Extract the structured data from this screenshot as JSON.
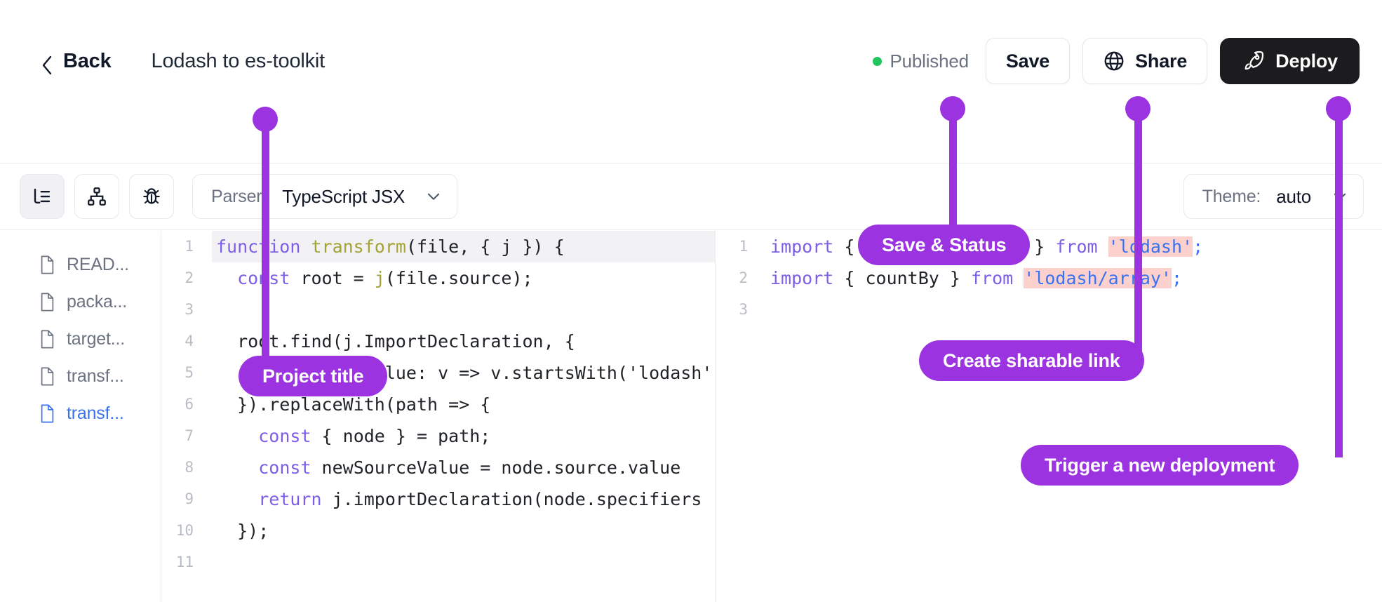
{
  "header": {
    "back_label": "Back",
    "back_icon": "chevron-left-icon",
    "project_title": "Lodash to es-toolkit",
    "status_text": "Published",
    "status_color": "#22c55e",
    "save_label": "Save",
    "share_label": "Share",
    "share_icon": "globe-icon",
    "deploy_label": "Deploy",
    "deploy_icon": "rocket-icon"
  },
  "toolbar": {
    "buttons": [
      {
        "name": "list-tree-icon",
        "active": true
      },
      {
        "name": "sitemap-icon",
        "active": false
      },
      {
        "name": "bug-icon",
        "active": false
      }
    ],
    "parser": {
      "label": "Parser:",
      "value": "TypeScript JSX",
      "chevron": "chevron-down-icon"
    },
    "theme": {
      "label": "Theme:",
      "value": "auto",
      "chevron": "chevron-down-icon"
    }
  },
  "files": [
    {
      "name": "READ...",
      "selected": false
    },
    {
      "name": "packa...",
      "selected": false
    },
    {
      "name": "target...",
      "selected": false
    },
    {
      "name": "transf...",
      "selected": false
    },
    {
      "name": "transf...",
      "selected": true
    }
  ],
  "left_editor": {
    "lines": [
      {
        "n": "1",
        "highlight": true,
        "tokens": [
          {
            "t": "function ",
            "c": "kw"
          },
          {
            "t": "transform",
            "c": "fn"
          },
          {
            "t": "(file, { j }) {",
            "c": "plain"
          }
        ]
      },
      {
        "n": "2",
        "highlight": false,
        "tokens": [
          {
            "t": "  ",
            "c": "plain"
          },
          {
            "t": "const",
            "c": "kw"
          },
          {
            "t": " root = ",
            "c": "plain"
          },
          {
            "t": "j",
            "c": "var"
          },
          {
            "t": "(file.source);",
            "c": "plain"
          }
        ]
      },
      {
        "n": "3",
        "highlight": false,
        "tokens": []
      },
      {
        "n": "4",
        "highlight": false,
        "tokens": [
          {
            "t": "  root.find(j.ImportDeclaration, {",
            "c": "plain"
          }
        ]
      },
      {
        "n": "5",
        "highlight": false,
        "tokens": [
          {
            "t": "    source: { value: v => v.startsWith('lodash') }",
            "c": "plain"
          }
        ]
      },
      {
        "n": "6",
        "highlight": false,
        "tokens": [
          {
            "t": "  }).replaceWith(path => {",
            "c": "plain"
          }
        ]
      },
      {
        "n": "7",
        "highlight": false,
        "tokens": [
          {
            "t": "    ",
            "c": "plain"
          },
          {
            "t": "const",
            "c": "kw"
          },
          {
            "t": " { node } = path;",
            "c": "plain"
          }
        ]
      },
      {
        "n": "8",
        "highlight": false,
        "tokens": [
          {
            "t": "    ",
            "c": "plain"
          },
          {
            "t": "const",
            "c": "kw"
          },
          {
            "t": " newSourceValue = node.source.value",
            "c": "plain"
          }
        ]
      },
      {
        "n": "9",
        "highlight": false,
        "tokens": [
          {
            "t": "    ",
            "c": "plain"
          },
          {
            "t": "return",
            "c": "kw"
          },
          {
            "t": " j.importDeclaration(node.specifiers",
            "c": "plain"
          }
        ]
      },
      {
        "n": "10",
        "highlight": false,
        "tokens": [
          {
            "t": "  });",
            "c": "plain"
          }
        ]
      },
      {
        "n": "11",
        "highlight": false,
        "tokens": []
      }
    ]
  },
  "right_editor": {
    "lines": [
      {
        "n": "1",
        "highlight": false,
        "tokens": [
          {
            "t": "import",
            "c": "kw"
          },
          {
            "t": " { debounce, chunk } ",
            "c": "plain"
          },
          {
            "t": "from",
            "c": "kw"
          },
          {
            "t": " ",
            "c": "plain"
          },
          {
            "t": "'lodash'",
            "c": "del"
          },
          {
            "t": ";",
            "c": "str"
          }
        ]
      },
      {
        "n": "2",
        "highlight": false,
        "tokens": [
          {
            "t": "import",
            "c": "kw"
          },
          {
            "t": " { countBy } ",
            "c": "plain"
          },
          {
            "t": "from",
            "c": "kw"
          },
          {
            "t": " ",
            "c": "plain"
          },
          {
            "t": "'lodash",
            "c": "del"
          },
          {
            "t": "/array'",
            "c": "del"
          },
          {
            "t": ";",
            "c": "str"
          }
        ]
      },
      {
        "n": "3",
        "highlight": true,
        "tokens": []
      }
    ]
  },
  "annotations": [
    {
      "label": "Project title",
      "accent": "#9c33e0"
    },
    {
      "label": "Save & Status",
      "accent": "#9c33e0"
    },
    {
      "label": "Create sharable link",
      "accent": "#9c33e0"
    },
    {
      "label": "Trigger a new deployment",
      "accent": "#9c33e0"
    }
  ]
}
